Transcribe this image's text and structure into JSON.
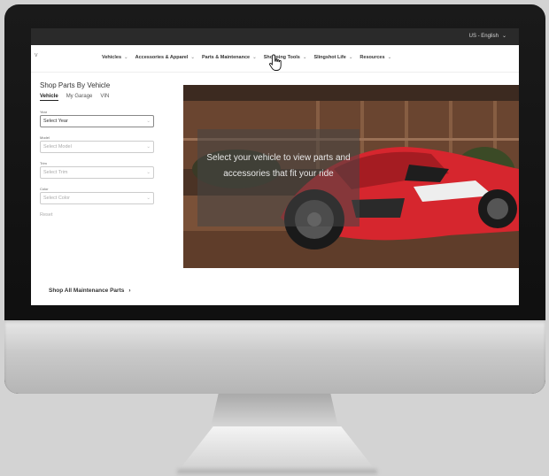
{
  "header": {
    "language": "US - English",
    "logo_char": "v"
  },
  "nav": {
    "items": [
      {
        "label": "Vehicles"
      },
      {
        "label": "Accessories & Apparel"
      },
      {
        "label": "Parts & Maintenance"
      },
      {
        "label": "Shopping Tools"
      },
      {
        "label": "Slingshot Life"
      },
      {
        "label": "Resources"
      }
    ]
  },
  "sidebar": {
    "title": "Shop Parts By Vehicle",
    "tabs": [
      "Vehicle",
      "My Garage",
      "VIN"
    ],
    "fields": [
      {
        "label": "Year",
        "value": "Select Year"
      },
      {
        "label": "Model",
        "value": "Select Model"
      },
      {
        "label": "Trim",
        "value": "Select Trim"
      },
      {
        "label": "Color",
        "value": "Select Color"
      }
    ],
    "reset": "Reset",
    "shop_all": "Shop All Maintenance Parts"
  },
  "hero": {
    "caption": "Select your vehicle to view parts and accessories that fit your ride"
  },
  "colors": {
    "vehicle_red": "#d6262e",
    "topbar": "#2a2a2a"
  }
}
